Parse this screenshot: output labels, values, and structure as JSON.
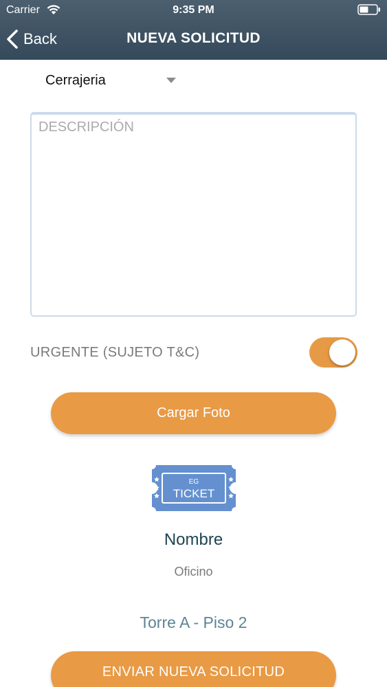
{
  "status_bar": {
    "carrier": "Carrier",
    "time": "9:35 PM"
  },
  "nav": {
    "back_label": "Back",
    "title": "NUEVA SOLICITUD"
  },
  "form": {
    "category": "Cerrajeria",
    "description_placeholder": "DESCRIPCIÓN",
    "urgent_label": "URGENTE (SUJETO T&C)",
    "urgent_on": true,
    "upload_photo_label": "Cargar Foto",
    "submit_label": "ENVIAR NUEVA SOLICITUD"
  },
  "logo": {
    "small_text": "EG",
    "big_text": "TICKET"
  },
  "company": {
    "name": "Nombre",
    "role": "Oficino",
    "location": "Torre A - Piso 2"
  },
  "colors": {
    "header_top": "#4c5f6f",
    "header_bottom": "#34495a",
    "accent_orange": "#e99a45",
    "logo_blue": "#6490cf",
    "name_text": "#1f4454",
    "location_text": "#5d8495"
  },
  "icons": [
    "wifi-icon",
    "battery-icon",
    "chevron-left-icon",
    "dropdown-caret-icon",
    "ticket-logo"
  ]
}
